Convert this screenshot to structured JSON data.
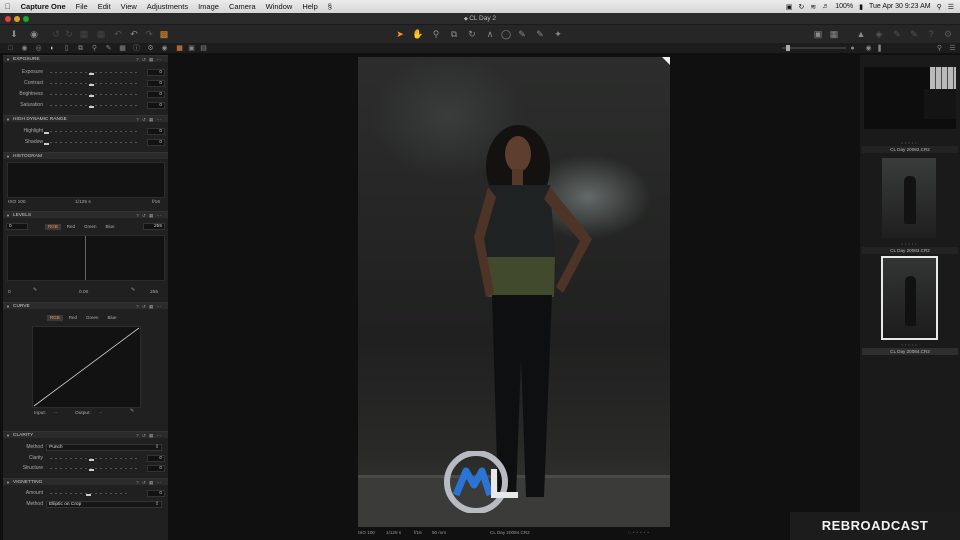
{
  "menubar": {
    "app_name": "Capture One",
    "items": [
      "File",
      "Edit",
      "View",
      "Adjustments",
      "Image",
      "Camera",
      "Window",
      "Help"
    ],
    "battery": "100%",
    "clock": "Tue Apr 30  9:23 AM"
  },
  "window": {
    "title": "CL Day 2"
  },
  "panels": {
    "exposure": {
      "title": "EXPOSURE",
      "rows": [
        {
          "label": "Exposure",
          "value": "0"
        },
        {
          "label": "Contrast",
          "value": "0"
        },
        {
          "label": "Brightness",
          "value": "0"
        },
        {
          "label": "Saturation",
          "value": "0"
        }
      ]
    },
    "hdr": {
      "title": "HIGH DYNAMIC RANGE",
      "rows": [
        {
          "label": "Highlight",
          "value": "0"
        },
        {
          "label": "Shadow",
          "value": "0"
        }
      ]
    },
    "histogram": {
      "title": "HISTOGRAM",
      "iso": "ISO 100",
      "shutter": "1/125 s",
      "aperture": "f/16"
    },
    "levels": {
      "title": "LEVELS",
      "low_input": "0",
      "high_input": "255",
      "tabs": [
        "RGB",
        "Red",
        "Green",
        "Blue"
      ],
      "low_output": "0",
      "mid": "0.00",
      "high_output": "255"
    },
    "curve": {
      "title": "CURVE",
      "tabs": [
        "RGB",
        "Red",
        "Green",
        "Blue"
      ],
      "input_label": "Input:",
      "input_value": "--",
      "output_label": "Output:",
      "output_value": "--"
    },
    "clarity": {
      "title": "CLARITY",
      "method_label": "Method",
      "method_value": "Punch",
      "rows": [
        {
          "label": "Clarity",
          "value": "0"
        },
        {
          "label": "Structure",
          "value": "0"
        }
      ]
    },
    "vignetting": {
      "title": "VIGNETTING",
      "amount_label": "Amount",
      "amount_value": "0",
      "method_label": "Method",
      "method_value": "Elliptic on Crop"
    }
  },
  "viewer": {
    "info": {
      "iso": "ISO 100",
      "shutter": "1/125 s",
      "aperture": "f/16",
      "focal": "50 mm",
      "filename": "CL Day 20084.CR2"
    }
  },
  "browser": {
    "thumbnails": [
      {
        "caption": "CL Day 20082.CR2",
        "selected": false
      },
      {
        "caption": "CL Day 20083.CR2",
        "selected": false
      },
      {
        "caption": "CL Day 20084.CR2",
        "selected": true
      }
    ]
  },
  "watermark": {
    "text": "REBROADCAST"
  },
  "colors": {
    "accent": "#ff8c3a",
    "panel": "#202020",
    "viewer": "#101010"
  }
}
